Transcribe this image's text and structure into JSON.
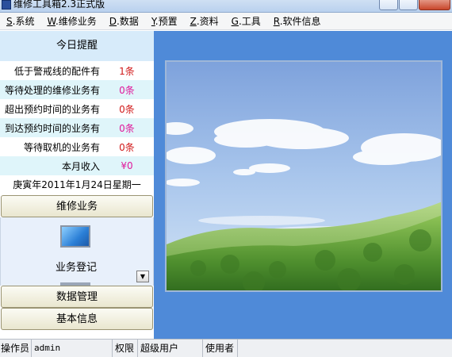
{
  "window": {
    "title": "维修工具箱2.3正式版"
  },
  "menu": [
    {
      "key": "S",
      "label": ".系统"
    },
    {
      "key": "W",
      "label": ".维修业务"
    },
    {
      "key": "D",
      "label": ".数据"
    },
    {
      "key": "Y",
      "label": ".预置"
    },
    {
      "key": "Z",
      "label": ".资料"
    },
    {
      "key": "G",
      "label": ".工具"
    },
    {
      "key": "R",
      "label": ".软件信息"
    }
  ],
  "today": {
    "header": "今日提醒",
    "rows": [
      {
        "label": "低于警戒线的配件有",
        "value": "1条"
      },
      {
        "label": "等待处理的维修业务有",
        "value": "0条"
      },
      {
        "label": "超出预约时间的业务有",
        "value": "0条"
      },
      {
        "label": "到达预约时间的业务有",
        "value": "0条"
      },
      {
        "label": "等待取机的业务有",
        "value": "0条"
      },
      {
        "label": "本月收入",
        "value": "¥0"
      }
    ],
    "date": "庚寅年2011年1月24日星期一"
  },
  "groups": {
    "repair_label": "维修业务",
    "item_label": "业务登记",
    "data_label": "数据管理",
    "basic_label": "基本信息"
  },
  "statusbar": {
    "operator_label": "操作员",
    "operator_value": "admin",
    "permission_label": "权限",
    "permission_value": "超级用户",
    "user_label": "使用者"
  },
  "colors": {
    "content_bg": "#4f8ad8",
    "value_red": "#d11a1a",
    "value_pink": "#e0199b"
  }
}
